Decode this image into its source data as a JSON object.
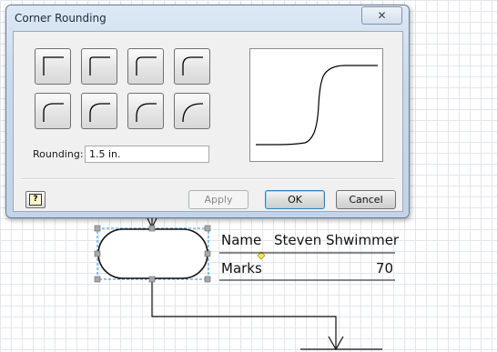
{
  "dialog": {
    "title": "Corner Rounding",
    "close_symbol": "✕",
    "rounding_label": "Rounding:",
    "rounding_value": "1.5 in.",
    "apply_label": "Apply",
    "ok_label": "OK",
    "cancel_label": "Cancel",
    "help_symbol": "?",
    "corner_presets": [
      "none",
      "small",
      "medium",
      "large",
      "xlarge",
      "xxlarge",
      "xxxlarge",
      "max"
    ]
  },
  "table": {
    "row1": {
      "label": "Name",
      "value": "Steven Shwimmer"
    },
    "row2": {
      "label": "Marks",
      "value": "70"
    }
  }
}
